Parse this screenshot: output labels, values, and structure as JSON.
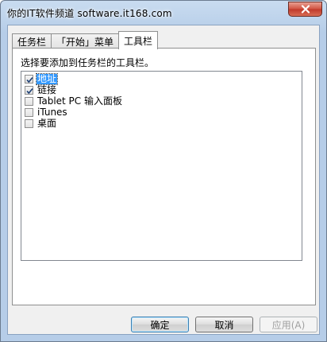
{
  "window": {
    "title": "你的IT软件频道 software.it168.com"
  },
  "tabs": [
    {
      "label": "任务栏",
      "active": false
    },
    {
      "label": "「开始」菜单",
      "active": false
    },
    {
      "label": "工具栏",
      "active": true
    }
  ],
  "toolbars_tab": {
    "prompt": "选择要添加到任务栏的工具栏。",
    "items": [
      {
        "label": "地址",
        "checked": true,
        "selected": true
      },
      {
        "label": "链接",
        "checked": true,
        "selected": false
      },
      {
        "label": "Tablet PC 输入面板",
        "checked": false,
        "selected": false
      },
      {
        "label": "iTunes",
        "checked": false,
        "selected": false
      },
      {
        "label": "桌面",
        "checked": false,
        "selected": false
      }
    ]
  },
  "buttons": {
    "ok": "确定",
    "cancel": "取消",
    "apply": "应用(A)"
  },
  "colors": {
    "selection": "#3399ff",
    "close_button": "#c7432f",
    "titlebar": "#c9dcf0"
  }
}
